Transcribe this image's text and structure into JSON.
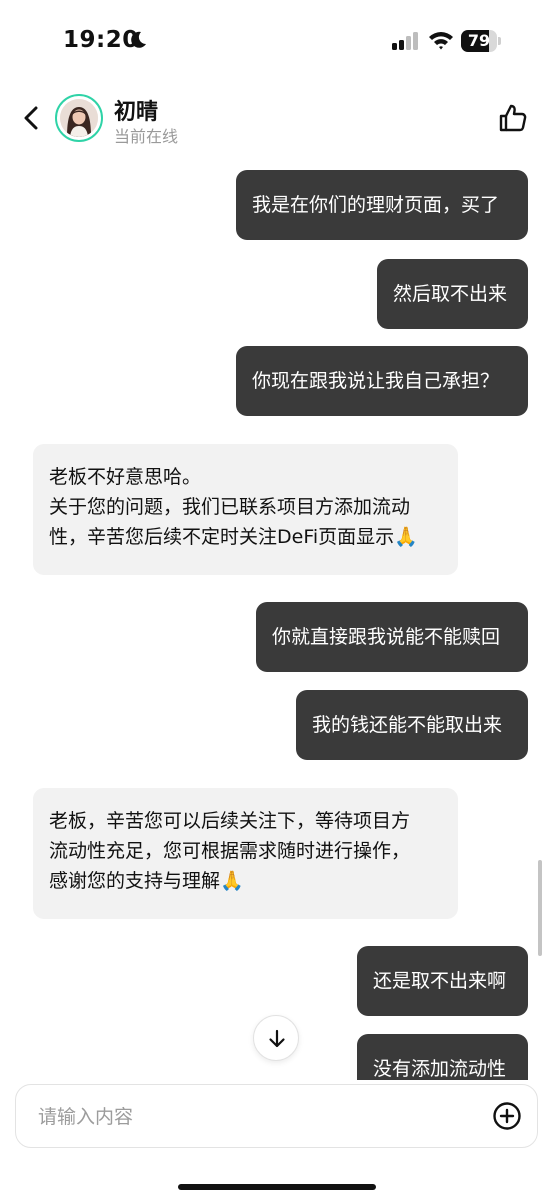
{
  "status_bar": {
    "time": "19:20",
    "battery": "79",
    "battery_level": 0.79
  },
  "header": {
    "contact_name": "初晴",
    "contact_status": "当前在线"
  },
  "messages": [
    {
      "direction": "out",
      "text": "我是在你们的理财页面，买了"
    },
    {
      "direction": "out",
      "text": "然后取不出来"
    },
    {
      "direction": "out",
      "text": "你现在跟我说让我自己承担？"
    },
    {
      "direction": "in",
      "text": "老板不好意思哈。\n关于您的问题，我们已联系项目方添加流动\n性，辛苦您后续不定时关注DeFi页面显示🙏"
    },
    {
      "direction": "out",
      "text": "你就直接跟我说能不能赎回"
    },
    {
      "direction": "out",
      "text": "我的钱还能不能取出来"
    },
    {
      "direction": "in",
      "text": "老板，辛苦您可以后续关注下，等待项目方\n流动性充足，您可根据需求随时进行操作，\n感谢您的支持与理解🙏"
    },
    {
      "direction": "out",
      "text": "还是取不出来啊"
    },
    {
      "direction": "out",
      "text": "没有添加流动性"
    }
  ],
  "composer": {
    "placeholder": "请输入内容"
  },
  "icons": {
    "back": "chevron-left-icon",
    "like": "thumbs-up-icon",
    "moon": "moon-icon",
    "signal": "cellular-signal-icon",
    "wifi": "wifi-icon",
    "scroll_down": "arrow-down-icon",
    "add": "plus-circle-icon"
  },
  "colors": {
    "accent_ring": "#2fd3a7",
    "outgoing_bubble": "#3a3a3a",
    "incoming_bubble": "#f2f2f2"
  }
}
